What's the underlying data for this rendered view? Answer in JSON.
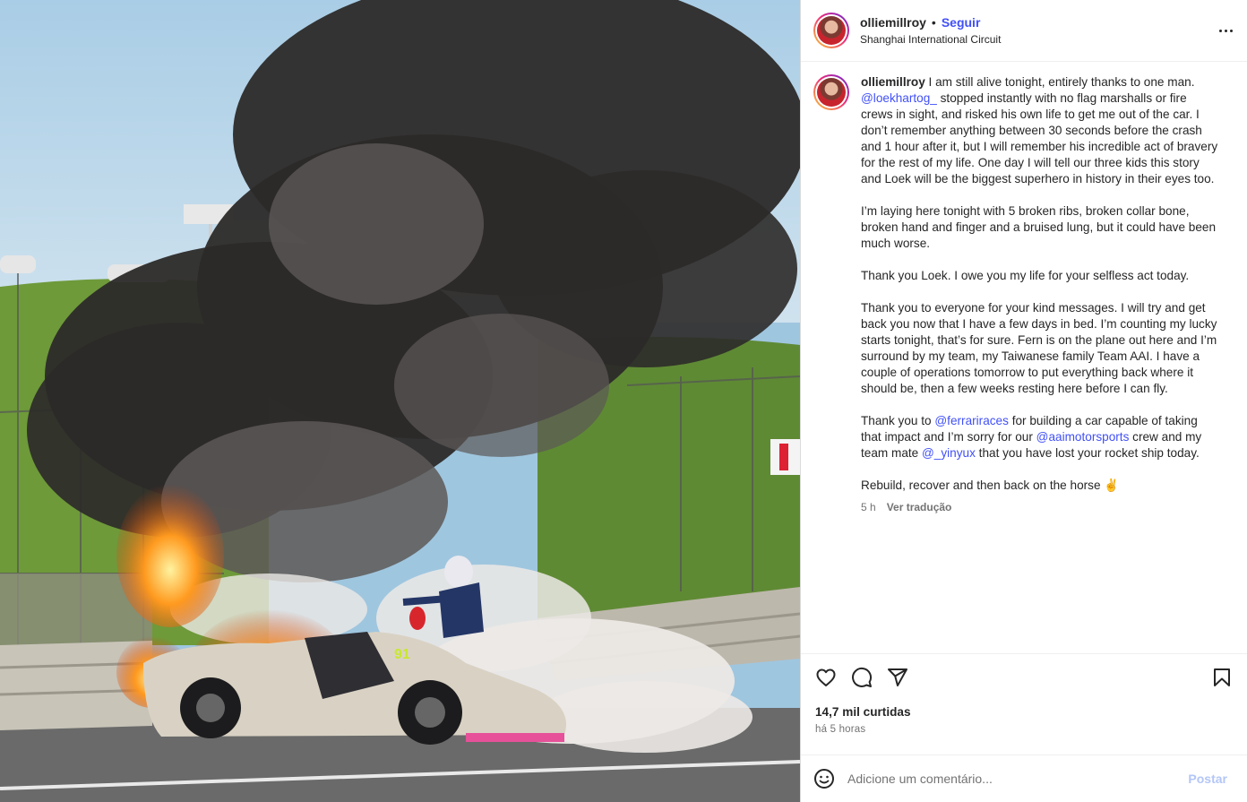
{
  "header": {
    "username": "olliemillroy",
    "separator": "•",
    "follow_label": "Seguir",
    "location": "Shanghai International Circuit"
  },
  "caption": {
    "username": "olliemillroy",
    "p1_a": " I am still alive tonight, entirely thanks to one man. ",
    "p1_mention": "@loekhartog_",
    "p1_b": " stopped instantly with no flag marshalls or fire crews in sight, and risked his own life to get me out of the car. I don’t remember anything between 30 seconds before the crash and 1 hour after it, but I will remember his incredible act of bravery for the rest of my life. One day I will tell our three kids this story and Loek will be the biggest superhero in history in their eyes too.",
    "p2": "I’m laying here tonight with 5 broken ribs, broken collar bone, broken hand and finger and a bruised lung, but it could have been much worse.",
    "p3": "Thank you Loek. I owe you my life for your selfless act today.",
    "p4": "Thank you to everyone for your kind messages. I will try and get back you now that I have a few days in bed. I’m counting my lucky starts tonight, that’s for sure. Fern is on the plane out here and I’m surround by my team, my Taiwanese family Team AAI. I have a couple of operations tomorrow to put everything back where it should be, then a few weeks resting here before I can fly.",
    "p5_a": "Thank you to ",
    "p5_m1": "@ferrariraces",
    "p5_b": " for building a car capable of taking that impact and I’m sorry for our ",
    "p5_m2": "@aaimotorsports",
    "p5_c": " crew and my team mate ",
    "p5_m3": "@_yinyux",
    "p5_d": " that you have lost your rocket ship today.",
    "p6": "Rebuild, recover and then back on the horse ✌️",
    "age": "5 h",
    "translate_label": "Ver tradução"
  },
  "engagement": {
    "likes": "14,7 mil curtidas",
    "posted": "há 5 horas"
  },
  "comment_box": {
    "placeholder": "Adicione um comentário...",
    "post_label": "Postar"
  },
  "icons": {
    "more": "more-options-icon",
    "like": "heart-icon",
    "comment": "comment-icon",
    "share": "share-icon",
    "save": "bookmark-icon",
    "emoji": "emoji-icon"
  },
  "colors": {
    "link": "#4150f7",
    "muted": "#737373",
    "post_disabled": "#b3c6f7"
  }
}
